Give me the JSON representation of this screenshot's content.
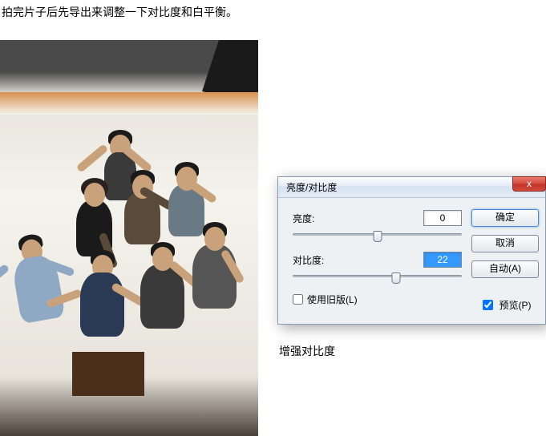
{
  "instruction_text": "拍完片子后先导出来调整一下对比度和白平衡。",
  "caption_text": "增强对比度",
  "dialog": {
    "title": "亮度/对比度",
    "close_glyph": "x",
    "brightness": {
      "label": "亮度:",
      "value": "0",
      "slider_pos_pct": 50
    },
    "contrast": {
      "label": "对比度:",
      "value": "22",
      "slider_pos_pct": 61
    },
    "use_legacy": {
      "label": "使用旧版(L)",
      "checked": false
    },
    "buttons": {
      "ok": "确定",
      "cancel": "取消",
      "auto": "自动(A)"
    },
    "preview": {
      "label": "预览(P)",
      "checked": true
    }
  },
  "chart_data": null
}
